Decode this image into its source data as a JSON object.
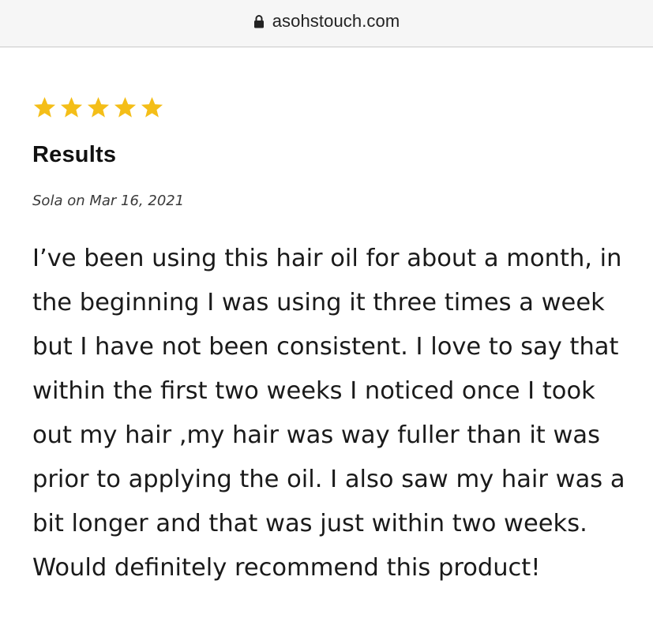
{
  "browser": {
    "url": "asohstouch.com",
    "lock_icon": "lock-icon"
  },
  "review": {
    "rating": 5,
    "rating_max": 5,
    "star_color": "#F4BE18",
    "title": "Results",
    "author_date": "Sola on Mar 16, 2021",
    "body": "I’ve been using this hair oil for about a month, in the beginning I was using it three times a week but I have not been consistent. I love to say that within the first two weeks I noticed once I took out my hair ,my hair was way fuller than it was prior to applying the oil. I also saw my hair was a bit longer and that was just within two weeks. Would definitely recommend this product!"
  }
}
